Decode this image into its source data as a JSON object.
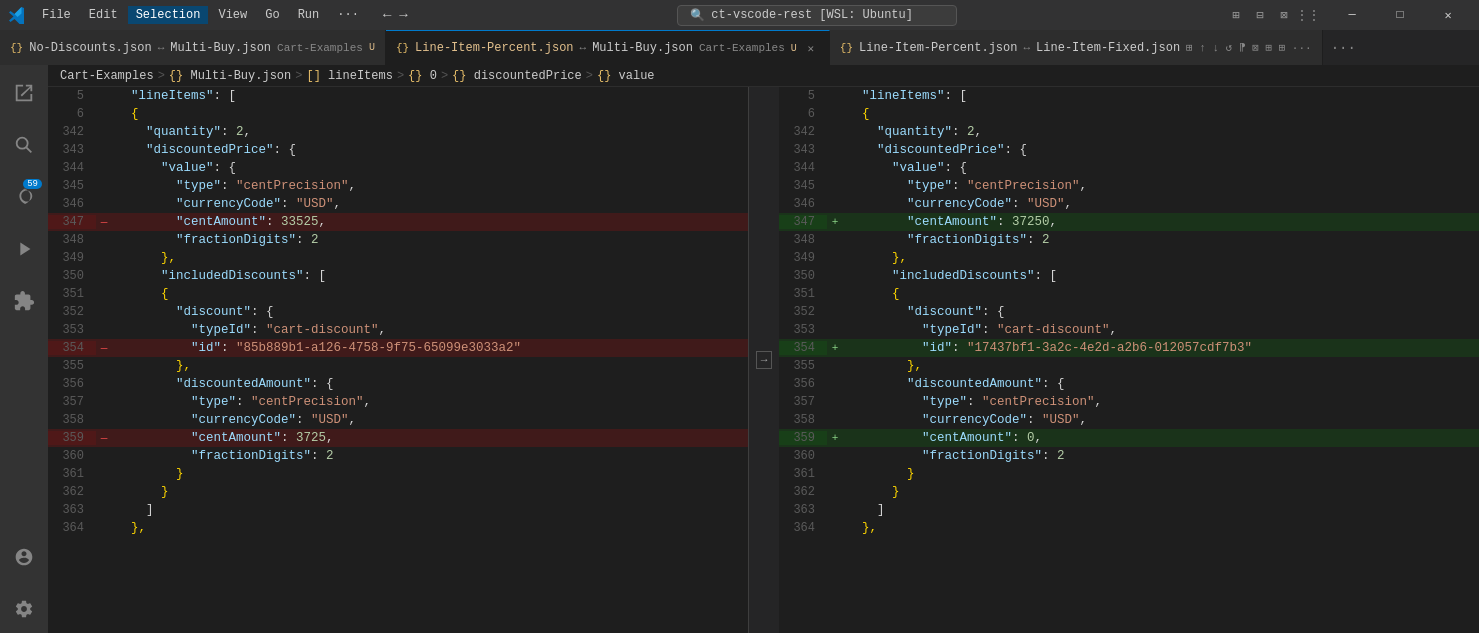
{
  "titlebar": {
    "menu_items": [
      "File",
      "Edit",
      "Selection",
      "View",
      "Go",
      "Run",
      "···"
    ],
    "search_text": "ct-vscode-rest [WSL: Ubuntu]",
    "nav_back": "←",
    "nav_fwd": "→",
    "selection_active": true
  },
  "tabs": [
    {
      "id": "tab1",
      "icon": "{}",
      "name": "No-Discounts.json",
      "arrow": "↔",
      "name2": "Multi-Buy.json",
      "badge": "Cart-Examples",
      "state": "U",
      "active": false,
      "closable": false
    },
    {
      "id": "tab2",
      "icon": "{}",
      "name": "Line-Item-Percent.json",
      "arrow": "↔",
      "name2": "Multi-Buy.json",
      "badge": "Cart-Examples",
      "state": "U",
      "active": true,
      "closable": true
    },
    {
      "id": "tab3",
      "icon": "{}",
      "name": "Line-Item-Percent.json",
      "arrow": "↔",
      "name2": "Line-Item-Fixed.json",
      "active": false,
      "closable": false
    }
  ],
  "breadcrumb": {
    "items": [
      "Cart-Examples",
      "> {} Multi-Buy.json",
      "> [] lineItems",
      "> {} 0",
      "> {} discountedPrice",
      "> {} value"
    ]
  },
  "left_pane": {
    "lines": [
      {
        "num": "5",
        "content": "  \"lineItems\": [",
        "type": "normal"
      },
      {
        "num": "6",
        "content": "  {",
        "type": "normal"
      },
      {
        "num": "342",
        "content": "    \"quantity\": 2,",
        "type": "normal"
      },
      {
        "num": "343",
        "content": "    \"discountedPrice\": {",
        "type": "normal"
      },
      {
        "num": "344",
        "content": "      \"value\": {",
        "type": "normal"
      },
      {
        "num": "345",
        "content": "        \"type\": \"centPrecision\",",
        "type": "normal"
      },
      {
        "num": "346",
        "content": "        \"currencyCode\": \"USD\",",
        "type": "normal"
      },
      {
        "num": "347",
        "content": "        \"centAmount\": 33525,",
        "type": "deleted",
        "marker": "—"
      },
      {
        "num": "348",
        "content": "        \"fractionDigits\": 2",
        "type": "normal"
      },
      {
        "num": "349",
        "content": "      },",
        "type": "normal"
      },
      {
        "num": "350",
        "content": "      \"includedDiscounts\": [",
        "type": "normal"
      },
      {
        "num": "351",
        "content": "      {",
        "type": "normal"
      },
      {
        "num": "352",
        "content": "        \"discount\": {",
        "type": "normal"
      },
      {
        "num": "353",
        "content": "          \"typeId\": \"cart-discount\",",
        "type": "normal"
      },
      {
        "num": "354",
        "content": "          \"id\": \"85b889b1-a126-4758-9f75-65099e3033a2\"",
        "type": "deleted",
        "marker": "—"
      },
      {
        "num": "355",
        "content": "        },",
        "type": "normal"
      },
      {
        "num": "356",
        "content": "        \"discountedAmount\": {",
        "type": "normal"
      },
      {
        "num": "357",
        "content": "          \"type\": \"centPrecision\",",
        "type": "normal"
      },
      {
        "num": "358",
        "content": "          \"currencyCode\": \"USD\",",
        "type": "normal"
      },
      {
        "num": "359",
        "content": "          \"centAmount\": 3725,",
        "type": "deleted",
        "marker": "—"
      },
      {
        "num": "360",
        "content": "          \"fractionDigits\": 2",
        "type": "normal"
      },
      {
        "num": "361",
        "content": "        }",
        "type": "normal"
      },
      {
        "num": "362",
        "content": "      }",
        "type": "normal"
      },
      {
        "num": "363",
        "content": "    ]",
        "type": "normal"
      },
      {
        "num": "364",
        "content": "  },",
        "type": "normal"
      }
    ]
  },
  "right_pane": {
    "lines": [
      {
        "num": "5",
        "content": "  \"lineItems\": [",
        "type": "normal"
      },
      {
        "num": "6",
        "content": "  {",
        "type": "normal"
      },
      {
        "num": "342",
        "content": "    \"quantity\": 2,",
        "type": "normal"
      },
      {
        "num": "343",
        "content": "    \"discountedPrice\": {",
        "type": "normal"
      },
      {
        "num": "344",
        "content": "      \"value\": {",
        "type": "normal"
      },
      {
        "num": "345",
        "content": "        \"type\": \"centPrecision\",",
        "type": "normal"
      },
      {
        "num": "346",
        "content": "        \"currencyCode\": \"USD\",",
        "type": "normal"
      },
      {
        "num": "347",
        "content": "        \"centAmount\": 37250,",
        "type": "added",
        "marker": "+"
      },
      {
        "num": "348",
        "content": "        \"fractionDigits\": 2",
        "type": "normal"
      },
      {
        "num": "349",
        "content": "      },",
        "type": "normal"
      },
      {
        "num": "350",
        "content": "      \"includedDiscounts\": [",
        "type": "normal"
      },
      {
        "num": "351",
        "content": "      {",
        "type": "normal"
      },
      {
        "num": "352",
        "content": "        \"discount\": {",
        "type": "normal"
      },
      {
        "num": "353",
        "content": "          \"typeId\": \"cart-discount\",",
        "type": "normal"
      },
      {
        "num": "354",
        "content": "          \"id\": \"17437bf1-3a2c-4e2d-a2b6-012057cdf7b3\"",
        "type": "added",
        "marker": "+"
      },
      {
        "num": "355",
        "content": "        },",
        "type": "normal"
      },
      {
        "num": "356",
        "content": "        \"discountedAmount\": {",
        "type": "normal"
      },
      {
        "num": "357",
        "content": "          \"type\": \"centPrecision\",",
        "type": "normal"
      },
      {
        "num": "358",
        "content": "          \"currencyCode\": \"USD\",",
        "type": "normal"
      },
      {
        "num": "359",
        "content": "          \"centAmount\": 0,",
        "type": "added",
        "marker": "+"
      },
      {
        "num": "360",
        "content": "          \"fractionDigits\": 2",
        "type": "normal"
      },
      {
        "num": "361",
        "content": "        }",
        "type": "normal"
      },
      {
        "num": "362",
        "content": "      }",
        "type": "normal"
      },
      {
        "num": "363",
        "content": "    ]",
        "type": "normal"
      },
      {
        "num": "364",
        "content": "  },",
        "type": "normal"
      }
    ]
  },
  "activity_buttons": [
    {
      "icon": "⊞",
      "label": "explorer-button",
      "active": false
    },
    {
      "icon": "🔍",
      "label": "search-button",
      "active": false
    },
    {
      "icon": "⑂",
      "label": "source-control-button",
      "active": false,
      "badge": "59"
    },
    {
      "icon": "▷",
      "label": "run-debug-button",
      "active": false
    },
    {
      "icon": "⬡",
      "label": "extensions-button",
      "active": false
    },
    {
      "icon": "⊙",
      "label": "git-history-button",
      "active": false
    },
    {
      "icon": "⧉",
      "label": "remote-button",
      "active": false
    }
  ],
  "colors": {
    "deleted_bg": "rgba(255,0,0,0.18)",
    "added_bg": "rgba(80,200,80,0.13)",
    "titlebar_bg": "#323233",
    "editor_bg": "#1e1e1e",
    "sidebar_bg": "#252526",
    "active_tab_indicator": "#007acc"
  }
}
